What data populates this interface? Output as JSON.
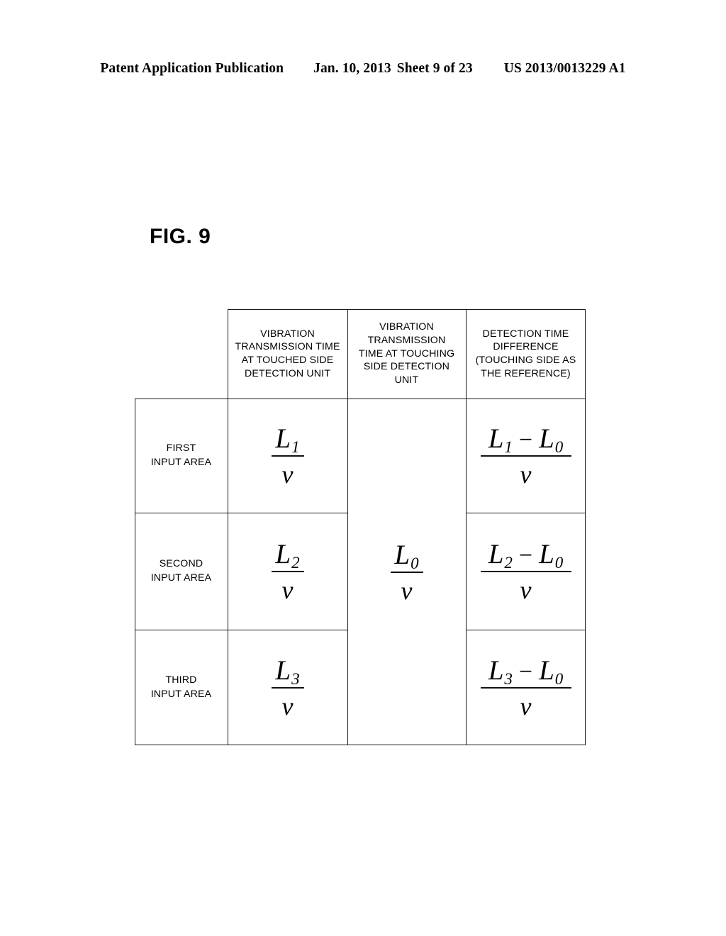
{
  "header": {
    "publication": "Patent Application Publication",
    "date": "Jan. 10, 2013",
    "sheet": "Sheet 9 of 23",
    "number": "US 2013/0013229 A1"
  },
  "figure": {
    "label": "FIG. 9",
    "table": {
      "corner_label": "",
      "columns": [
        "VIBRATION TRANSMISSION TIME AT TOUCHED SIDE DETECTION UNIT",
        "VIBRATION TRANSMISSION TIME AT TOUCHING SIDE DETECTION UNIT",
        "DETECTION TIME DIFFERENCE (TOUCHING SIDE AS THE REFERENCE)"
      ],
      "column_lines": [
        [
          "VIBRATION",
          "TRANSMISSION TIME",
          "AT TOUCHED SIDE",
          "DETECTION UNIT"
        ],
        [
          "VIBRATION",
          "TRANSMISSION",
          "TIME AT TOUCHING",
          "SIDE DETECTION",
          "UNIT"
        ],
        [
          "DETECTION TIME",
          "DIFFERENCE",
          "(TOUCHING SIDE AS",
          "THE REFERENCE)"
        ]
      ],
      "rows": [
        {
          "label": "FIRST INPUT AREA",
          "label_lines": [
            "FIRST",
            "INPUT AREA"
          ],
          "touched_side": {
            "numerator": "L1",
            "base": "L",
            "sub": "1",
            "denominator": "v",
            "text": "L1 / v"
          },
          "difference": {
            "numerator": "L1 - L0",
            "base1": "L",
            "sub1": "1",
            "operator": "−",
            "base2": "L",
            "sub2": "0",
            "denominator": "v",
            "text": "(L1 - L0) / v"
          }
        },
        {
          "label": "SECOND INPUT AREA",
          "label_lines": [
            "SECOND",
            "INPUT  AREA"
          ],
          "touched_side": {
            "numerator": "L2",
            "base": "L",
            "sub": "2",
            "denominator": "v",
            "text": "L2 / v"
          },
          "difference": {
            "numerator": "L2 - L0",
            "base1": "L",
            "sub1": "2",
            "operator": "−",
            "base2": "L",
            "sub2": "0",
            "denominator": "v",
            "text": "(L2 - L0) / v"
          }
        },
        {
          "label": "THIRD INPUT AREA",
          "label_lines": [
            "THIRD",
            "INPUT AREA"
          ],
          "touched_side": {
            "numerator": "L3",
            "base": "L",
            "sub": "3",
            "denominator": "v",
            "text": "L3 / v"
          },
          "difference": {
            "numerator": "L3 - L0",
            "base1": "L",
            "sub1": "3",
            "operator": "−",
            "base2": "L",
            "sub2": "0",
            "denominator": "v",
            "text": "(L3 - L0) / v"
          }
        }
      ],
      "touching_side_merged": {
        "numerator": "L0",
        "base": "L",
        "sub": "0",
        "denominator": "v",
        "text": "L0 / v",
        "note": "spans all three rows"
      }
    }
  },
  "colors": {
    "ink": "#1a1a1a",
    "page": "#ffffff"
  }
}
